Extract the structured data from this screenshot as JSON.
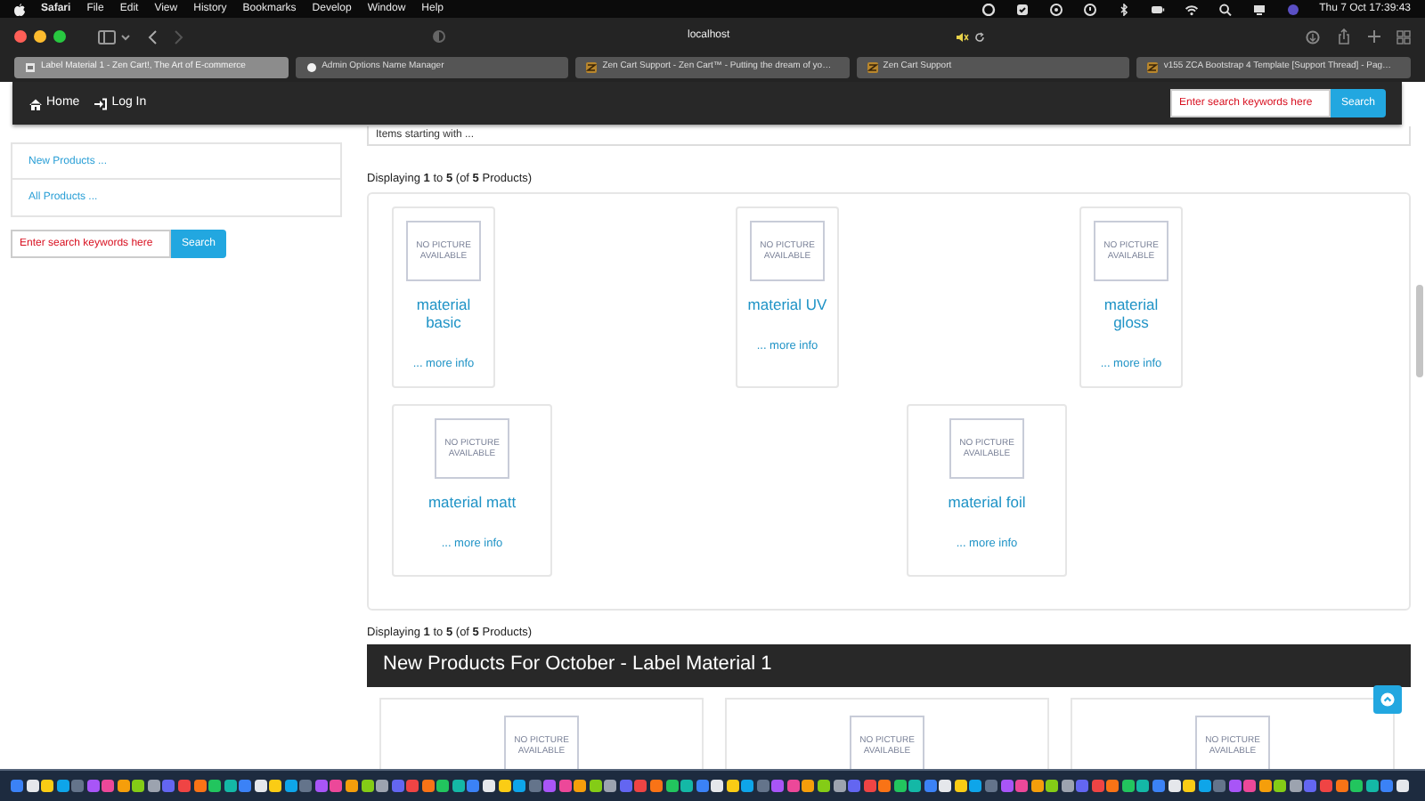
{
  "menubar": {
    "app": "Safari",
    "menus": [
      "File",
      "Edit",
      "View",
      "History",
      "Bookmarks",
      "Develop",
      "Window",
      "Help"
    ],
    "clock": "Thu 7 Oct  17:39:43"
  },
  "browser": {
    "address": "localhost",
    "tabs": [
      {
        "title": "Label Material 1 - Zen Cart!, The Art of E-commerce",
        "selected": true
      },
      {
        "title": "Admin Options Name Manager",
        "selected": false
      },
      {
        "title": "Zen Cart Support - Zen Cart™ - Putting the dream of yo…",
        "selected": false
      },
      {
        "title": "Zen Cart Support",
        "selected": false
      },
      {
        "title": "v155 ZCA Bootstrap 4 Template [Support Thread] - Pag…",
        "selected": false
      }
    ]
  },
  "navbar": {
    "links": [
      "Home",
      "Log In"
    ],
    "search": {
      "placeholder": "Enter search keywords here",
      "button": "Search"
    }
  },
  "sidebar": {
    "items": [
      "New Products ...",
      "All Products ..."
    ],
    "search": {
      "placeholder": "Enter search keywords here",
      "button": "Search"
    }
  },
  "filter": {
    "value": "Items starting with ..."
  },
  "listing": {
    "summary": "Displaying **1** to **5** (of **5** Products)",
    "rows": [
      [
        {
          "name": "material basic",
          "image_text": "NO PICTURE AVAILABLE",
          "link": "... more info"
        },
        {
          "name": "material UV",
          "image_text": "NO PICTURE AVAILABLE",
          "link": "... more info"
        },
        {
          "name": "material gloss",
          "image_text": "NO PICTURE AVAILABLE",
          "link": "... more info"
        }
      ],
      [
        {
          "name": "material matt",
          "image_text": "NO PICTURE AVAILABLE",
          "link": "... more info"
        },
        {
          "name": "material foil",
          "image_text": "NO PICTURE AVAILABLE",
          "link": "... more info"
        }
      ]
    ],
    "footer": "Displaying **1** to **5** (of **5** Products)"
  },
  "new_products": {
    "title": "New Products For October - Label Material 1",
    "items": [
      {
        "image_text": "NO PICTURE AVAILABLE"
      },
      {
        "image_text": "NO PICTURE AVAILABLE"
      },
      {
        "image_text": "NO PICTURE AVAILABLE"
      }
    ]
  }
}
